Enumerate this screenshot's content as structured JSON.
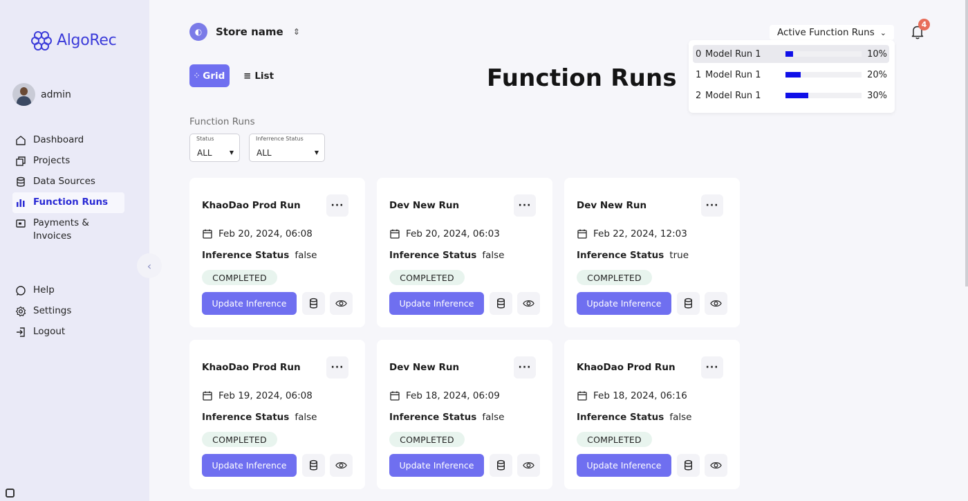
{
  "brand": {
    "name": "AlgoRec",
    "accent": "#3b3bd9"
  },
  "user": {
    "name": "admin"
  },
  "nav": {
    "items": [
      {
        "label": "Dashboard",
        "icon": "home-icon"
      },
      {
        "label": "Projects",
        "icon": "projects-icon"
      },
      {
        "label": "Data Sources",
        "icon": "database-icon"
      },
      {
        "label": "Function Runs",
        "icon": "bar-chart-icon",
        "active": true
      },
      {
        "label": "Payments & Invoices",
        "icon": "invoice-icon"
      }
    ],
    "bottom": [
      {
        "label": "Help",
        "icon": "help-icon"
      },
      {
        "label": "Settings",
        "icon": "gear-icon"
      },
      {
        "label": "Logout",
        "icon": "logout-icon"
      }
    ]
  },
  "store": {
    "name": "Store name"
  },
  "view": {
    "grid_label": "Grid",
    "list_label": "List",
    "selected": "Grid"
  },
  "page": {
    "title": "Function Runs",
    "section_label": "Function Runs"
  },
  "filters": {
    "status": {
      "label": "Status",
      "value": "ALL"
    },
    "inference_status": {
      "label": "Inferrence Status",
      "value": "ALL"
    }
  },
  "cards": [
    {
      "title": "KhaoDao Prod Run",
      "date": "Feb 20, 2024, 06:08",
      "inference_label": "Inference Status",
      "inference_value": "false",
      "status": "COMPLETED",
      "action": "Update Inference"
    },
    {
      "title": "Dev New Run",
      "date": "Feb 20, 2024, 06:03",
      "inference_label": "Inference Status",
      "inference_value": "false",
      "status": "COMPLETED",
      "action": "Update Inference"
    },
    {
      "title": "Dev New Run",
      "date": "Feb 22, 2024, 12:03",
      "inference_label": "Inference Status",
      "inference_value": "true",
      "status": "COMPLETED",
      "action": "Update Inference"
    },
    {
      "title": "KhaoDao Prod Run",
      "date": "Feb 19, 2024, 06:08",
      "inference_label": "Inference Status",
      "inference_value": "false",
      "status": "COMPLETED",
      "action": "Update Inference"
    },
    {
      "title": "Dev New Run",
      "date": "Feb 18, 2024, 06:09",
      "inference_label": "Inference Status",
      "inference_value": "false",
      "status": "COMPLETED",
      "action": "Update Inference"
    },
    {
      "title": "KhaoDao Prod Run",
      "date": "Feb 18, 2024, 06:16",
      "inference_label": "Inference Status",
      "inference_value": "false",
      "status": "COMPLETED",
      "action": "Update Inference"
    }
  ],
  "active_runs": {
    "label": "Active Function Runs",
    "notifications": "4",
    "runs": [
      {
        "index": "0",
        "name": "Model Run 1",
        "progress": 10,
        "progress_label": "10%"
      },
      {
        "index": "1",
        "name": "Model Run 1",
        "progress": 20,
        "progress_label": "20%"
      },
      {
        "index": "2",
        "name": "Model Run 1",
        "progress": 30,
        "progress_label": "30%"
      }
    ]
  },
  "colors": {
    "primary_button": "#6f6ff0",
    "progress": "#1010e8",
    "badge_bg": "#e8f4ee",
    "notification": "#e86e5a"
  }
}
